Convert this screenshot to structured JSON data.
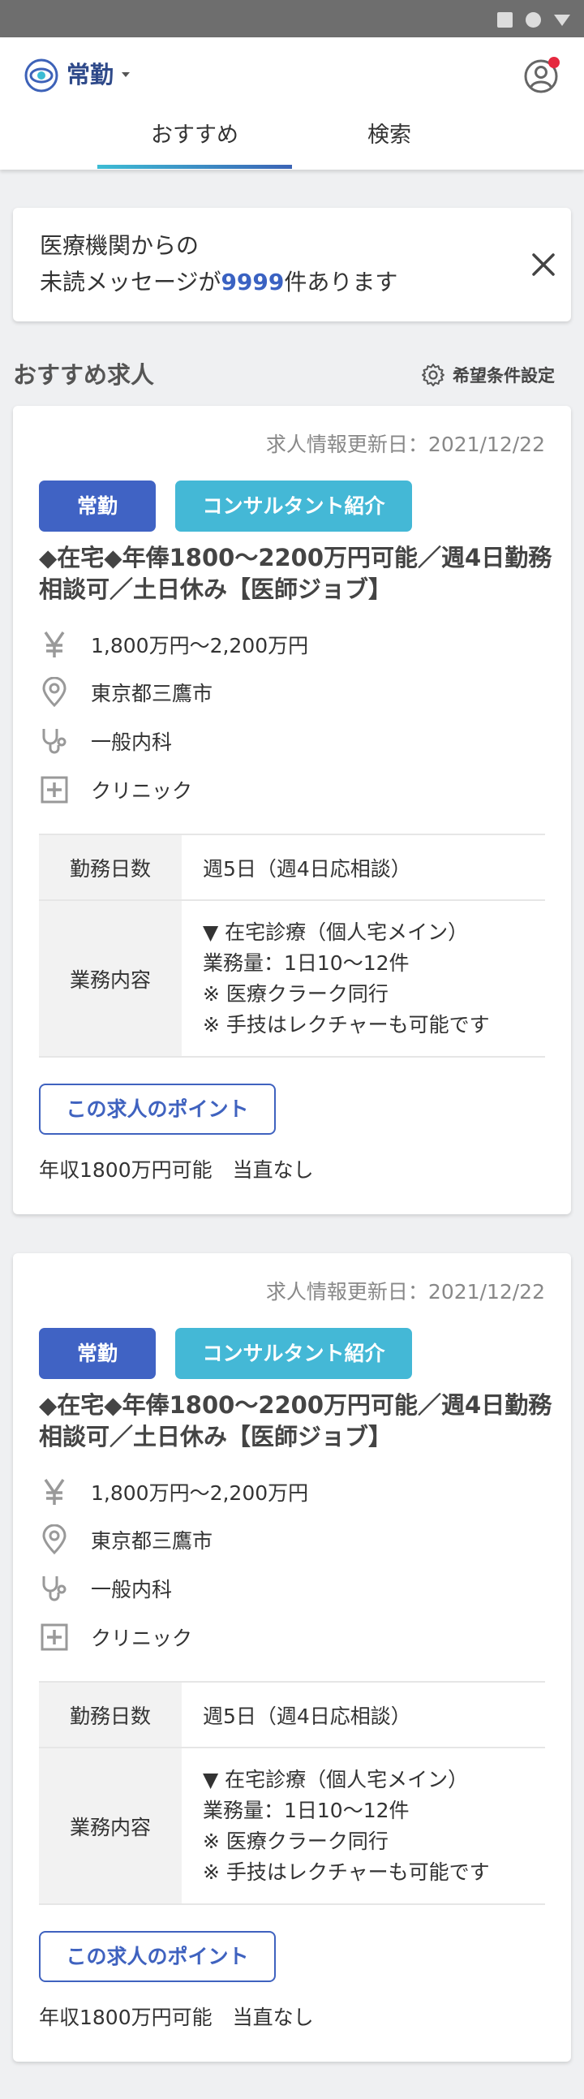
{
  "header": {
    "title": "常勤",
    "tabs": [
      {
        "label": "おすすめ"
      },
      {
        "label": "検索"
      }
    ]
  },
  "notice": {
    "line1": "医療機関からの",
    "line2_prefix": "未読メッセージが",
    "count": "9999",
    "line2_suffix": "件あります"
  },
  "section": {
    "title": "おすすめ求人",
    "settings_label": "希望条件設定"
  },
  "jobs": [
    {
      "updated": "求人情報更新日：2021/12/22",
      "type_badge": "常勤",
      "consult_badge": "コンサルタント紹介",
      "title": "◆在宅◆年俸1800〜2200万円可能／週4日勤務相談可／土日休み【医師ジョブ】",
      "salary": "1,800万円〜2,200万円",
      "location": "東京都三鷹市",
      "department": "一般内科",
      "facility": "クリニック",
      "table": {
        "days_label": "勤務日数",
        "days_value": "週5日（週4日応相談）",
        "work_label": "業務内容",
        "work_lines": [
          "▼ 在宅診療（個人宅メイン）",
          "業務量：1日10〜12件",
          "※ 医療クラーク同行",
          "※ 手技はレクチャーも可能です"
        ]
      },
      "point_button": "この求人のポイント",
      "summary": "年収1800万円可能　当直なし"
    },
    {
      "updated": "求人情報更新日：2021/12/22",
      "type_badge": "常勤",
      "consult_badge": "コンサルタント紹介",
      "title": "◆在宅◆年俸1800〜2200万円可能／週4日勤務相談可／土日休み【医師ジョブ】",
      "salary": "1,800万円〜2,200万円",
      "location": "東京都三鷹市",
      "department": "一般内科",
      "facility": "クリニック",
      "table": {
        "days_label": "勤務日数",
        "days_value": "週5日（週4日応相談）",
        "work_label": "業務内容",
        "work_lines": [
          "▼ 在宅診療（個人宅メイン）",
          "業務量：1日10〜12件",
          "※ 医療クラーク同行",
          "※ 手技はレクチャーも可能です"
        ]
      },
      "point_button": "この求人のポイント",
      "summary": "年収1800万円可能　当直なし"
    }
  ],
  "icons": {
    "logo": "eye-logo-icon",
    "user": "user-account-icon",
    "close": "close-icon",
    "settings": "gear-icon",
    "salary": "yen-icon",
    "location": "map-pin-icon",
    "department": "stethoscope-icon",
    "facility": "medical-cross-icon"
  },
  "colors": {
    "brand": "#2f4a8a",
    "accent_blue": "#4063c4",
    "accent_cyan": "#44b8d6",
    "notification_dot": "#e5293f"
  }
}
